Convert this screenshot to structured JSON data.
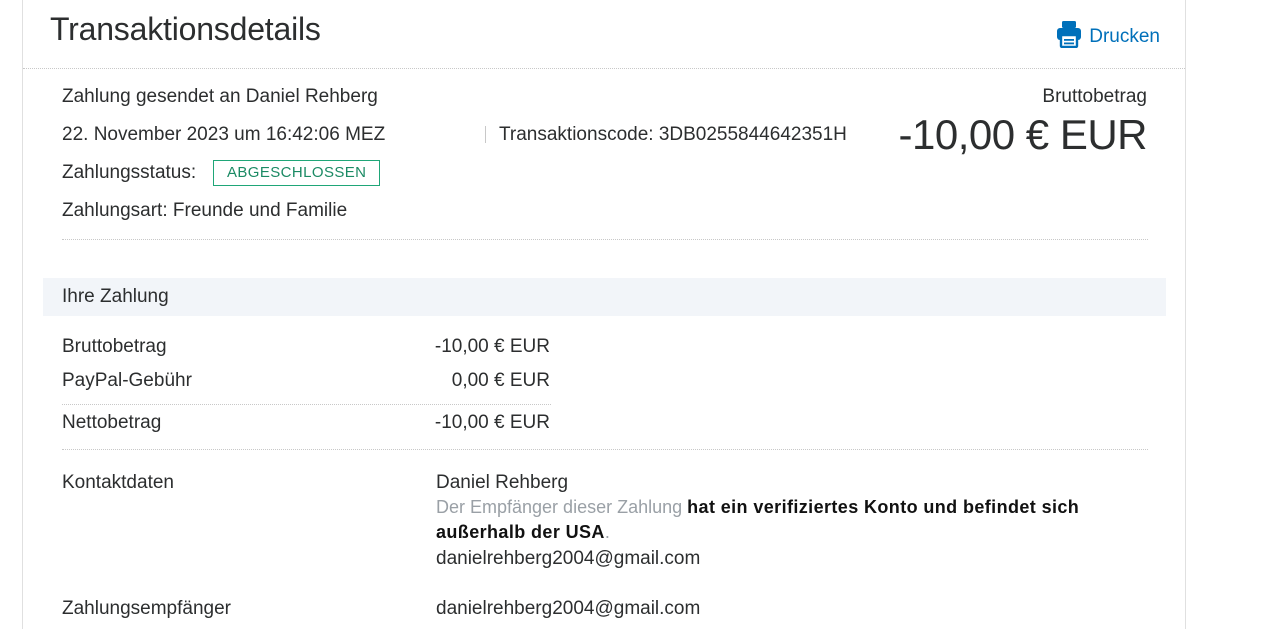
{
  "header": {
    "title": "Transaktionsdetails",
    "print_label": "Drucken"
  },
  "summary": {
    "payment_sent_to": "Zahlung gesendet an Daniel Rehberg",
    "datetime": "22. November 2023 um 16:42:06 MEZ",
    "transaction_code": "Transaktionscode: 3DB0255844642351H",
    "status_label": "Zahlungsstatus:",
    "status_value": "ABGESCHLOSSEN",
    "payment_type": "Zahlungsart: Freunde und Familie",
    "gross_label": "Bruttobetrag",
    "gross_amount": "-10,00 € EUR"
  },
  "your_payment": {
    "section_title": "Ihre Zahlung",
    "rows": [
      {
        "label": "Bruttobetrag",
        "value": "-10,00 € EUR"
      },
      {
        "label": "PayPal-Gebühr",
        "value": "0,00 € EUR"
      },
      {
        "label": "Nettobetrag",
        "value": "-10,00 € EUR"
      }
    ]
  },
  "contact": {
    "label": "Kontaktdaten",
    "name": "Daniel Rehberg",
    "note_muted": "Der Empfänger dieser Zahlung ",
    "note_bold": "hat ein verifiziertes Konto und befindet sich außerhalb der USA",
    "note_end": ".",
    "email": "danielrehberg2004@gmail.com"
  },
  "recipient": {
    "label": "Zahlungsempfänger",
    "value": "danielrehberg2004@gmail.com"
  },
  "colors": {
    "accent": "#0070ba",
    "status_green": "#1fa678",
    "section_bg": "#f2f5f9"
  },
  "icons": {
    "print": "printer-icon"
  }
}
